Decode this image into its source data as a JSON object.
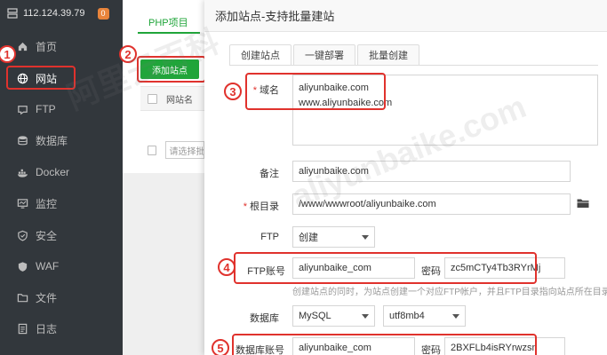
{
  "sidebar": {
    "ip": "112.124.39.79",
    "badge": "0",
    "items": [
      {
        "label": "首页",
        "icon": "home-icon"
      },
      {
        "label": "网站",
        "icon": "globe-icon"
      },
      {
        "label": "FTP",
        "icon": "ftp-icon"
      },
      {
        "label": "数据库",
        "icon": "database-icon"
      },
      {
        "label": "Docker",
        "icon": "docker-icon"
      },
      {
        "label": "监控",
        "icon": "monitor-icon"
      },
      {
        "label": "安全",
        "icon": "shield-icon"
      },
      {
        "label": "WAF",
        "icon": "waf-icon"
      },
      {
        "label": "文件",
        "icon": "file-icon"
      },
      {
        "label": "日志",
        "icon": "log-icon"
      }
    ]
  },
  "background": {
    "tab": "PHP项目",
    "add_button": "添加站点",
    "table_header": "网站名",
    "select_placeholder": "请选择批"
  },
  "dialog": {
    "title": "添加站点-支持批量建站",
    "tabs": [
      "创建站点",
      "一键部署",
      "批量创建"
    ],
    "domain_label": "域名",
    "domain_lines": [
      "aliyunbaike.com",
      "www.aliyunbaike.com"
    ],
    "remark_label": "备注",
    "remark_value": "aliyunbaike.com",
    "root_label": "根目录",
    "root_value": "/www/wwwroot/aliyunbaike.com",
    "ftp_label": "FTP",
    "ftp_value": "创建",
    "ftp_account_label": "FTP账号",
    "ftp_account_value": "aliyunbaike_com",
    "ftp_password_label": "密码",
    "ftp_password_value": "zc5mCTy4Tb3RYrMj",
    "ftp_hint": "创建站点的同时，为站点创建一个对应FTP帐户，并且FTP目录指向站点所在目录。",
    "db_label": "数据库",
    "db_type": "MySQL",
    "db_charset": "utf8mb4",
    "db_account_label": "数据库账号",
    "db_account_value": "aliyunbaike_com",
    "db_password_label": "密码",
    "db_password_value": "2BXFLb4isRYrwzsn"
  },
  "steps": [
    "1",
    "2",
    "3",
    "4",
    "5"
  ],
  "watermark": [
    "阿里云百科",
    "aliyunbaike.com"
  ],
  "colors": {
    "sidebar_bg": "#32373c",
    "accent_green": "#20a53a",
    "highlight_red": "#e0322d"
  }
}
